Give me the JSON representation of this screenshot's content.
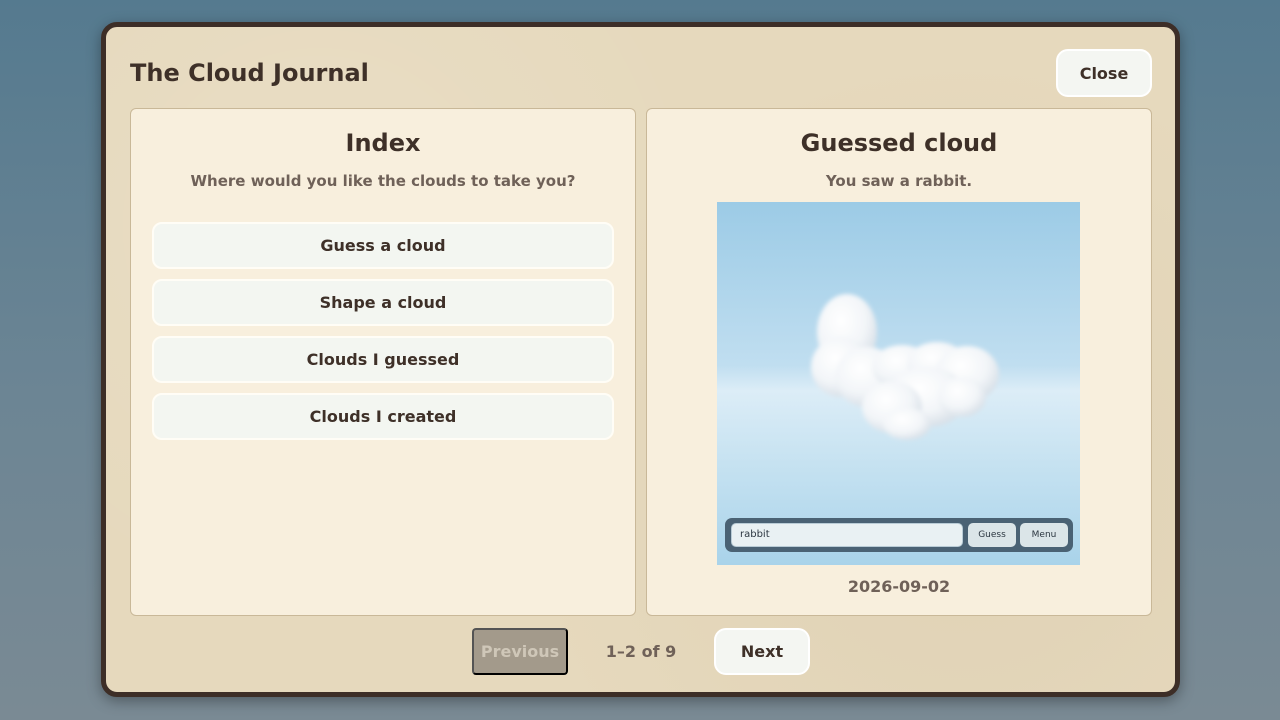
{
  "journal": {
    "title": "The Cloud Journal",
    "close_label": "Close"
  },
  "index_panel": {
    "title": "Index",
    "subtitle": "Where would you like the clouds to take you?",
    "items": [
      {
        "label": "Guess a cloud"
      },
      {
        "label": "Shape a cloud"
      },
      {
        "label": "Clouds I guessed"
      },
      {
        "label": "Clouds I created"
      }
    ]
  },
  "detail_panel": {
    "title": "Guessed cloud",
    "subtitle": "You saw a rabbit.",
    "thumbnail": {
      "guess_value": "rabbit",
      "guess_button": "Guess",
      "menu_button": "Menu"
    },
    "date": "2026-09-02"
  },
  "pagination": {
    "previous_label": "Previous",
    "previous_disabled": true,
    "count_text": "1–2 of 9",
    "next_label": "Next"
  },
  "colors": {
    "frame": "#3d2e27",
    "paper": "#e6d9bd",
    "panel": "#f8efdd",
    "button": "#f4f6f2",
    "text": "#3e3028",
    "muted_text": "#6f6158"
  }
}
